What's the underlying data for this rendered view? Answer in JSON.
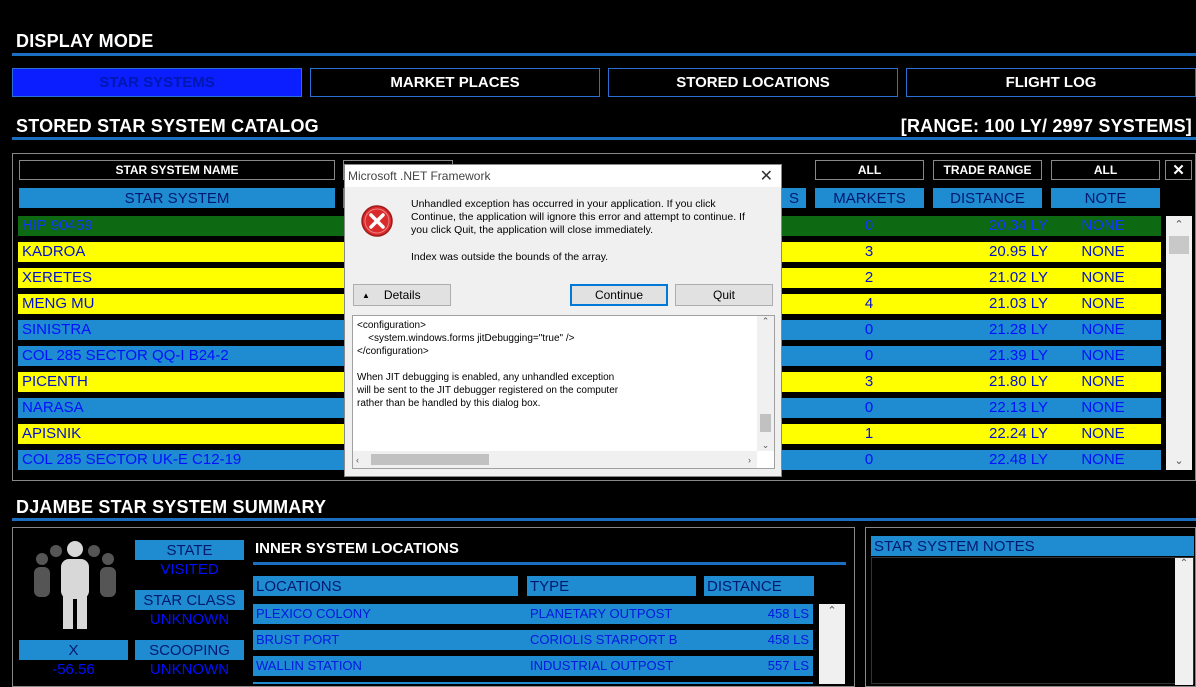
{
  "display_mode": {
    "title": "DISPLAY MODE",
    "buttons": [
      "STAR SYSTEMS",
      "MARKET PLACES",
      "STORED LOCATIONS",
      "FLIGHT LOG"
    ]
  },
  "catalog": {
    "title": "STORED STAR SYSTEM CATALOG",
    "range": "[RANGE: 100 LY/ 2997 SYSTEMS]",
    "filters": {
      "name": "STAR SYSTEM NAME",
      "markets": "ALL",
      "trade_range": "TRADE RANGE",
      "note": "ALL",
      "close": "✕"
    },
    "columns": {
      "system": "STAR SYSTEM",
      "partial": "S",
      "markets": "MARKETS",
      "distance": "DISTANCE",
      "note": "NOTE"
    },
    "rows": [
      {
        "name": "HIP 90459",
        "markets": "0",
        "distance": "20.34 LY",
        "note": "NONE",
        "bg": "#0e6a12",
        "fg": "#1236ff"
      },
      {
        "name": "KADROA",
        "markets": "3",
        "distance": "20.95 LY",
        "note": "NONE",
        "bg": "#ffff00",
        "fg": "#0010cc"
      },
      {
        "name": "XERETES",
        "markets": "2",
        "distance": "21.02 LY",
        "note": "NONE",
        "bg": "#ffff00",
        "fg": "#0010cc"
      },
      {
        "name": "MENG MU",
        "markets": "4",
        "distance": "21.03 LY",
        "note": "NONE",
        "bg": "#ffff00",
        "fg": "#0010cc"
      },
      {
        "name": "SINISTRA",
        "markets": "0",
        "distance": "21.28 LY",
        "note": "NONE",
        "bg": "#1f8bd0",
        "fg": "#0010ff"
      },
      {
        "name": "COL 285 SECTOR QQ-I B24-2",
        "markets": "0",
        "distance": "21.39 LY",
        "note": "NONE",
        "bg": "#1f8bd0",
        "fg": "#0010ff"
      },
      {
        "name": "PICENTH",
        "markets": "3",
        "distance": "21.80 LY",
        "note": "NONE",
        "bg": "#ffff00",
        "fg": "#0010cc"
      },
      {
        "name": "NARASA",
        "markets": "0",
        "distance": "22.13 LY",
        "note": "NONE",
        "bg": "#1f8bd0",
        "fg": "#0010ff"
      },
      {
        "name": "APISNIK",
        "markets": "1",
        "distance": "22.24 LY",
        "note": "NONE",
        "bg": "#ffff00",
        "fg": "#0010cc"
      },
      {
        "name": "COL 285 SECTOR UK-E C12-19",
        "markets": "0",
        "distance": "22.48 LY",
        "note": "NONE",
        "bg": "#1f8bd0",
        "fg": "#0010ff"
      }
    ]
  },
  "summary": {
    "title": "DJAMBE STAR SYSTEM SUMMARY",
    "state_label": "STATE",
    "state_value": "VISITED",
    "class_label": "STAR CLASS",
    "class_value": "UNKNOWN",
    "x_label": "X",
    "x_value": "-56.56",
    "scoop_label": "SCOOPING",
    "scoop_value": "UNKNOWN",
    "inner_title": "INNER SYSTEM LOCATIONS",
    "loc_columns": {
      "locations": "LOCATIONS",
      "type": "TYPE",
      "distance": "DISTANCE"
    },
    "locations": [
      {
        "name": "PLEXICO COLONY",
        "type": "PLANETARY OUTPOST",
        "distance": "458 LS"
      },
      {
        "name": "BRUST PORT",
        "type": "CORIOLIS STARPORT B",
        "distance": "458 LS"
      },
      {
        "name": "WALLIN STATION",
        "type": "INDUSTRIAL OUTPOST",
        "distance": "557 LS"
      }
    ],
    "notes_title": "STAR SYSTEM NOTES"
  },
  "dialog": {
    "title": "Microsoft .NET Framework",
    "message": "Unhandled exception has occurred in your application. If you click Continue, the application will ignore this error and attempt to continue. If you click Quit, the application will close immediately.",
    "detail": "Index was outside the bounds of the array.",
    "details_btn": "Details",
    "continue_btn": "Continue",
    "quit_btn": "Quit",
    "text_lines": [
      "<configuration>",
      "    <system.windows.forms jitDebugging=\"true\" />",
      "</configuration>",
      "",
      "When JIT debugging is enabled, any unhandled exception",
      "will be sent to the JIT debugger registered on the computer",
      "rather than be handled by this dialog box."
    ]
  }
}
